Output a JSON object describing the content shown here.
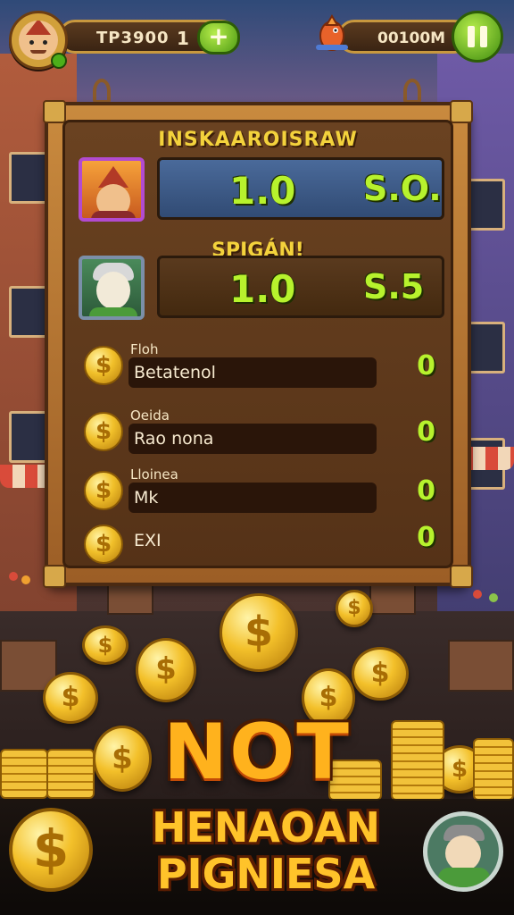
{
  "top_bar": {
    "score_label": "TP3900",
    "score_count": "1",
    "add_label": "+",
    "timer": "00100M"
  },
  "board": {
    "title": "INSKAAROISRAW",
    "player1": {
      "value": "1.0",
      "score": "S.O."
    },
    "subtitle": "SPIGÁN!",
    "player2": {
      "value": "1.0",
      "score": "S.5"
    },
    "stats": [
      {
        "caption": "Floh",
        "label": "Betatenol",
        "value": "0"
      },
      {
        "caption": "Oeida",
        "label": "Rao nona",
        "value": "0"
      },
      {
        "caption": "Lloinea",
        "label": "Mk",
        "value": "0"
      },
      {
        "caption": "",
        "label": "EXI",
        "value": "0"
      }
    ]
  },
  "promo": {
    "line1": "NOT",
    "line2": "HENAOAN",
    "line3": "PIGNIESA"
  },
  "icons": {
    "coin_symbol": "$",
    "avatar": "player-avatar-icon",
    "fish": "fish-icon",
    "pause": "pause-icon",
    "friend": "friend-avatar-icon"
  },
  "colors": {
    "accent_green": "#b7f22d",
    "title_yellow": "#f3d23c",
    "coin_gold": "#f3c02a",
    "board_wood": "#6a4221"
  }
}
